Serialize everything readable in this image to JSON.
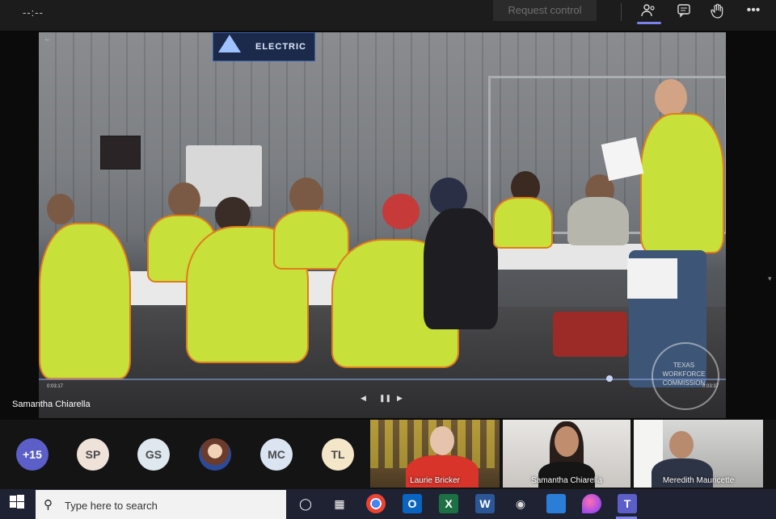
{
  "topbar": {
    "timer": "--:--",
    "request_control_label": "Request control",
    "icons": [
      "people-icon",
      "chat-icon",
      "raise-hand-icon",
      "more-options-icon"
    ]
  },
  "stage": {
    "presenter_name": "Samantha Chiarella",
    "video": {
      "current_time": "0:03:17",
      "duration": "0:03:37",
      "progress": 0.83,
      "sign_text": "ELECTRIC",
      "watermark_text": "TEXAS WORKFORCE COMMISSION"
    }
  },
  "participants": {
    "overflow_count": "+15",
    "avatars": [
      "SP",
      "GS",
      "MC",
      "TL"
    ],
    "tiles": [
      {
        "name": "Laurie Bricker"
      },
      {
        "name": "Samantha Chiarella"
      },
      {
        "name": "Meredith Mauricette"
      }
    ]
  },
  "taskbar": {
    "search_placeholder": "Type here to search",
    "apps": [
      "cortana-icon",
      "task-view-icon",
      "chrome-icon",
      "outlook-icon",
      "excel-icon",
      "word-icon",
      "camera-icon",
      "photos-icon",
      "paint-icon",
      "teams-icon"
    ]
  },
  "colors": {
    "teams_accent": "#5b5fc7",
    "vest_yellow": "#c8e03a",
    "vest_orange": "#e07c1c"
  }
}
